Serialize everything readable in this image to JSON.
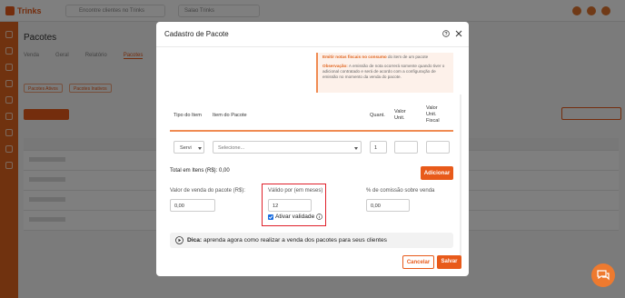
{
  "background": {
    "app_name": "Trinks",
    "search_placeholder": "Encontre clientes no Trinks",
    "store_label": "Salao Trinks",
    "page_title": "Pacotes",
    "tabs": [
      "Venda",
      "Geral",
      "Relatório",
      "Pacotes"
    ],
    "chips": [
      "Pacotes Ativos",
      "Pacotes Inativos"
    ]
  },
  "modal": {
    "title": "Cadastro de Pacote",
    "notice": {
      "line1_bold": "Emitir notas fiscais no consumo",
      "line1_rest": " do item de um pacote",
      "obs_bold": "Observação:",
      "obs_text": " A emissão de nota ocorrerá somente quando tiver o adicional contratado e será de acordo com a configuração de emissão no momento da venda do pacote."
    },
    "table": {
      "headers": {
        "tipo": "Tipo do Item",
        "item": "Item do Pacote",
        "quant": "Quant.",
        "valor_unit": "Valor Unit.",
        "valor_fiscal": "Valor Unit. Fiscal"
      },
      "row": {
        "tipo_value": "Servi",
        "item_placeholder": "Selecione...",
        "quant_value": "1",
        "valor_unit_value": "",
        "valor_fiscal_value": ""
      }
    },
    "total_label": "Total em Itens (R$): 0,00",
    "add_button": "Adicionar",
    "fields": {
      "valor_venda_label": "Valor de venda do pacote (R$):",
      "valor_venda_value": "0,00",
      "validade_label": "Válido por (em meses)",
      "validade_value": "12",
      "ativar_label": "Ativar validade",
      "ativar_checked": true,
      "comissao_label": "% de comissão sobre venda",
      "comissao_value": "0,00"
    },
    "tip": {
      "bold": "Dica:",
      "text": " aprenda agora como realizar a venda dos pacotes para seus clientes"
    },
    "cancel_button": "Cancelar",
    "save_button": "Salvar"
  },
  "colors": {
    "accent": "#e85a1a",
    "highlight": "#e0202a",
    "checkbox": "#1a6de0"
  }
}
